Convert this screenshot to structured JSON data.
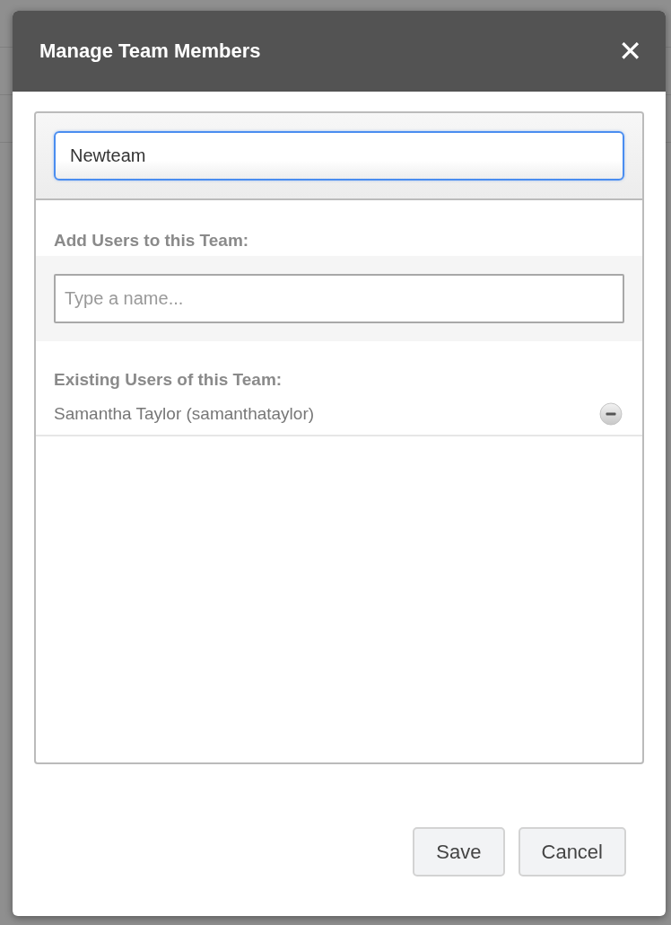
{
  "dialog": {
    "title": "Manage Team Members",
    "close_label": "✕"
  },
  "team_name": {
    "value": "Newteam",
    "focused": true
  },
  "add_users": {
    "label": "Add Users to this Team:",
    "placeholder": "Type a name..."
  },
  "existing_users": {
    "label": "Existing Users of this Team:",
    "members": [
      {
        "name": "Samantha Taylor (samanthataylor)"
      }
    ]
  },
  "buttons": [
    {
      "label": "Save"
    },
    {
      "label": "Cancel"
    }
  ]
}
